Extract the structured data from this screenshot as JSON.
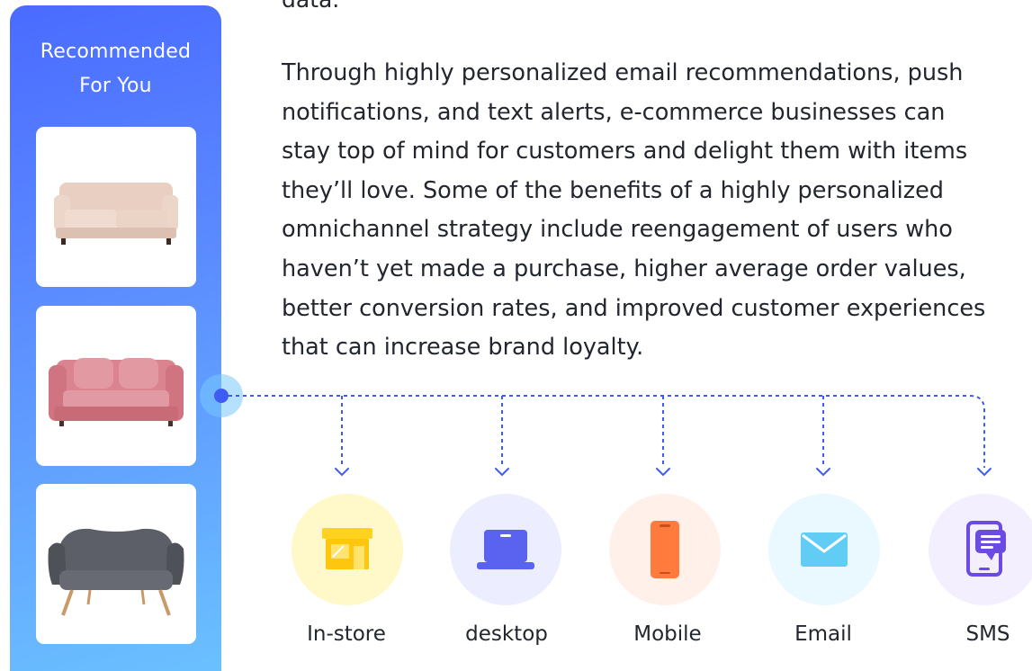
{
  "recommendation_panel": {
    "title_line_1": "Recommended",
    "title_line_2": "For You",
    "products": [
      {
        "name": "beige-sofa"
      },
      {
        "name": "pink-loveseat"
      },
      {
        "name": "gray-loveseat"
      }
    ]
  },
  "article": {
    "top_cutoff_text": "data.",
    "paragraph_lines": [
      "Through highly personalized email recommendations, push",
      "notifications, and text alerts, e-commerce businesses can",
      "stay top of mind for customers and delight them with items",
      "they’ll love. Some of the benefits of a highly personalized",
      "omnichannel strategy include reengagement of users who",
      "haven’t yet made a purchase, higher average order values,",
      "better conversion rates, and improved customer experiences",
      "that can increase brand loyalty."
    ]
  },
  "channels": [
    {
      "label": "In-store",
      "icon": "store-icon",
      "bg": "#fff8c8",
      "accent": "#ffd21f"
    },
    {
      "label": "desktop",
      "icon": "laptop-icon",
      "bg": "#eceeff",
      "accent": "#5a62f0"
    },
    {
      "label": "Mobile",
      "icon": "phone-icon",
      "bg": "#fff1ea",
      "accent": "#ff7a3d"
    },
    {
      "label": "Email",
      "icon": "email-icon",
      "bg": "#eaf8ff",
      "accent": "#62cdf4"
    },
    {
      "label": "SMS",
      "icon": "sms-icon",
      "bg": "#f3efff",
      "accent": "#6b4be0"
    }
  ],
  "colors": {
    "connector": "#3f5cf2",
    "panel_gradient_start": "#4a6bff",
    "panel_gradient_end": "#6bc3ff"
  }
}
